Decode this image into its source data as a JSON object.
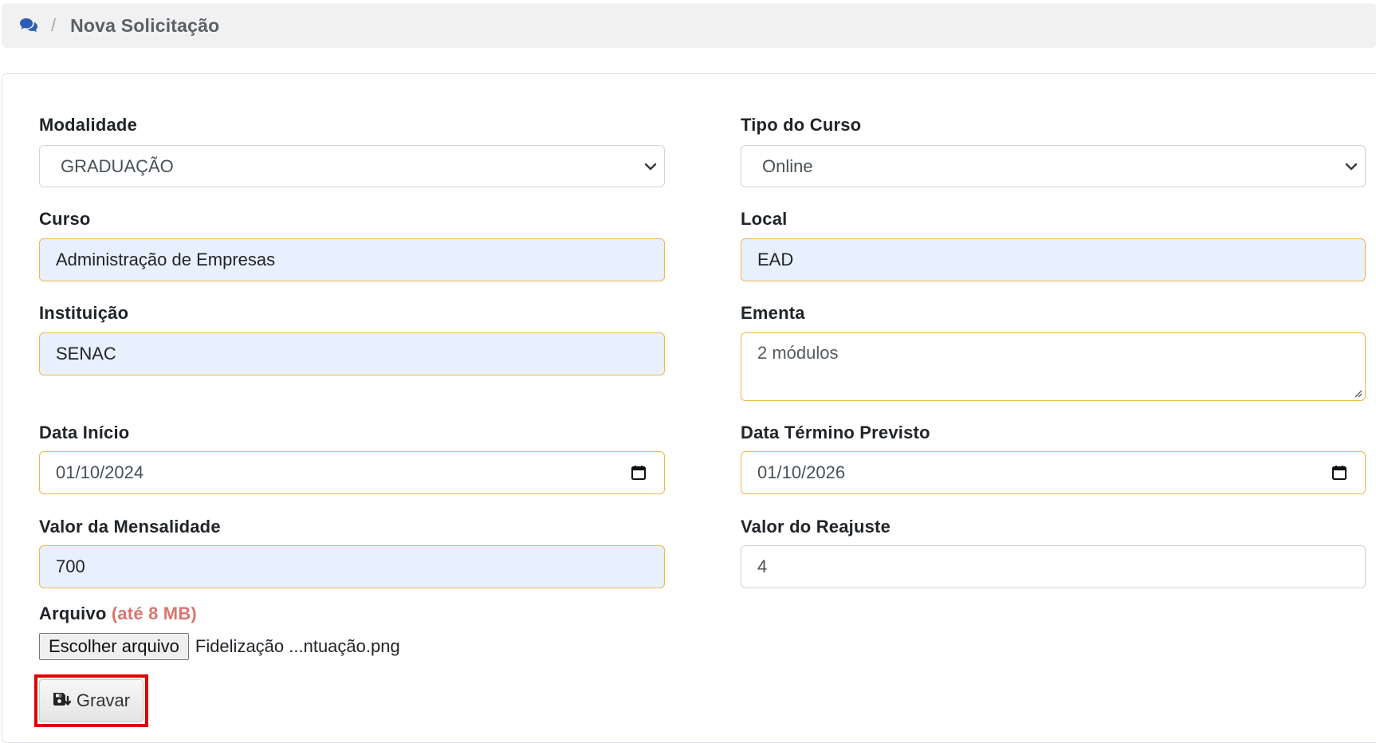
{
  "breadcrumb": {
    "icon": "comments-icon",
    "separator": "/",
    "title": "Nova Solicitação"
  },
  "form": {
    "modalidade": {
      "label": "Modalidade",
      "value": "GRADUAÇÃO"
    },
    "tipo_curso": {
      "label": "Tipo do Curso",
      "value": "Online"
    },
    "curso": {
      "label": "Curso",
      "value": "Administração de Empresas"
    },
    "local": {
      "label": "Local",
      "value": "EAD"
    },
    "instituicao": {
      "label": "Instituição",
      "value": "SENAC"
    },
    "ementa": {
      "label": "Ementa",
      "value": "2 módulos"
    },
    "data_inicio": {
      "label": "Data Início",
      "value": "01/10/2024"
    },
    "data_termino": {
      "label": "Data Término Previsto",
      "value": "01/10/2026"
    },
    "valor_mensalidade": {
      "label": "Valor da Mensalidade",
      "value": "700"
    },
    "valor_reajuste": {
      "label": "Valor do Reajuste",
      "value": "4"
    },
    "arquivo": {
      "label": "Arquivo",
      "hint": "(até 8 MB)",
      "button_label": "Escolher arquivo",
      "file_name": "Fidelização ...ntuação.png"
    },
    "save_label": "Gravar"
  },
  "colors": {
    "focus_border": "#f0b64b",
    "autofill_bg": "#e8f0fe",
    "highlight_border": "#e10000",
    "hint_text": "#d9756f"
  }
}
